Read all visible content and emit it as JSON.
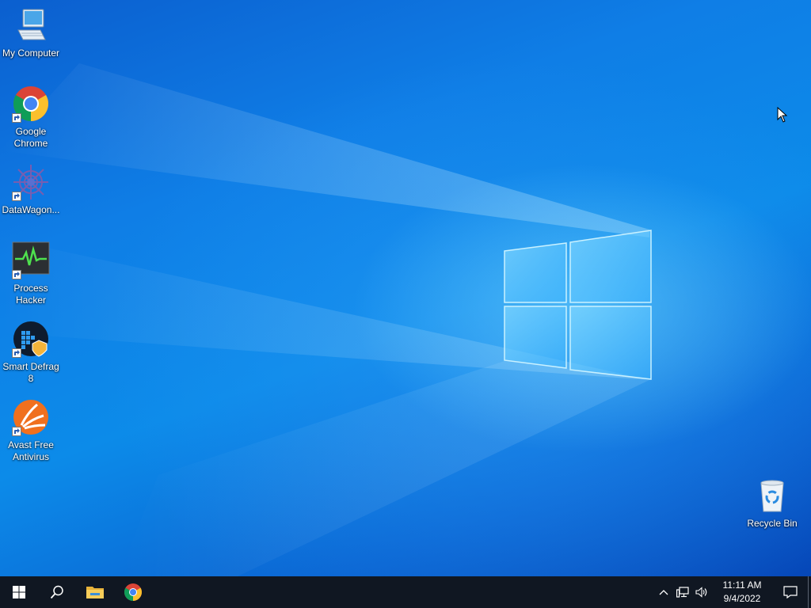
{
  "desktop": {
    "icons": [
      {
        "label": "My Computer",
        "icon": "computer-icon"
      },
      {
        "label": "Google Chrome",
        "icon": "chrome-icon"
      },
      {
        "label": "DataWagon...",
        "icon": "datawagon-icon"
      },
      {
        "label": "Process Hacker",
        "icon": "process-hacker-icon"
      },
      {
        "label": "Smart Defrag 8",
        "icon": "smart-defrag-icon"
      },
      {
        "label": "Avast Free Antivirus",
        "icon": "avast-icon"
      }
    ],
    "recycle_bin": {
      "label": "Recycle Bin",
      "icon": "recycle-bin-icon"
    }
  },
  "taskbar": {
    "start": {
      "icon": "windows-start-icon"
    },
    "search": {
      "icon": "search-icon"
    },
    "pinned": [
      {
        "name": "File Explorer",
        "icon": "folder-icon"
      },
      {
        "name": "Google Chrome",
        "icon": "chrome-icon"
      }
    ],
    "tray": {
      "icons": [
        "chevron-up-icon",
        "network-icon",
        "volume-icon"
      ],
      "time": "11:11 AM",
      "date": "9/4/2022",
      "notifications_icon": "notification-icon"
    }
  },
  "colors": {
    "accent": "#0a6fd6",
    "taskbar": "#101722"
  }
}
